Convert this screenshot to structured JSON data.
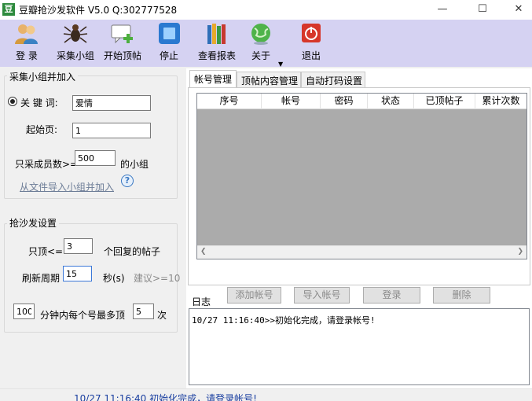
{
  "window": {
    "app_icon_char": "豆",
    "title": "豆瓣抢沙发软件 V5.0 Q:302777528",
    "minimize": "—",
    "maximize": "☐",
    "close": "✕"
  },
  "toolbar": {
    "items": [
      {
        "label": "登 录",
        "icon": "users-login-icon"
      },
      {
        "label": "采集小组",
        "icon": "spider-icon"
      },
      {
        "label": "开始顶帖",
        "icon": "comment-add-icon"
      },
      {
        "label": "停止",
        "icon": "stop-icon"
      },
      {
        "label": "查看报表",
        "icon": "books-report-icon"
      },
      {
        "label": "关于",
        "icon": "globe-icon"
      },
      {
        "label": "退出",
        "icon": "power-icon"
      }
    ],
    "colors": {
      "background": "#d5d2f2"
    }
  },
  "collect": {
    "group_title": "采集小组并加入",
    "keyword_label": "关 键 词:",
    "keyword_value": "爱情",
    "start_page_label": "起始页:",
    "start_page_value": "1",
    "min_members_label": "只采成员数>=",
    "min_members_value": "500",
    "min_members_suffix": "的小组",
    "import_link": "从文件导入小组并加入",
    "help_icon_char": "?"
  },
  "sofa": {
    "group_title": "抢沙发设置",
    "only_top_label": "只顶<=",
    "only_top_value": "3",
    "only_top_suffix": "个回复的帖子",
    "refresh_label": "刷新周期",
    "refresh_value": "15",
    "refresh_unit": "秒(s)",
    "refresh_hint": "建议>=10",
    "limit_minutes_value": "100",
    "limit_mid_label": "分钟内每个号最多顶",
    "limit_count_value": "5",
    "limit_suffix": "次"
  },
  "tabs": [
    {
      "label": "帐号管理",
      "active": true
    },
    {
      "label": "顶帖内容管理",
      "active": false
    },
    {
      "label": "自动打码设置",
      "active": false
    }
  ],
  "accounts_table": {
    "columns": [
      "序号",
      "帐号",
      "密码",
      "状态",
      "已顶帖子",
      "累计次数"
    ],
    "rows": []
  },
  "account_buttons": {
    "add": "添加帐号",
    "import": "导入帐号",
    "login": "登录",
    "delete": "删除"
  },
  "log": {
    "title": "日志",
    "lines": [
      "10/27 11:16:40>>初始化完成，请登录帐号!"
    ]
  },
  "status": {
    "text": "10/27 11:16:40 初始化完成，请登录帐号!"
  }
}
